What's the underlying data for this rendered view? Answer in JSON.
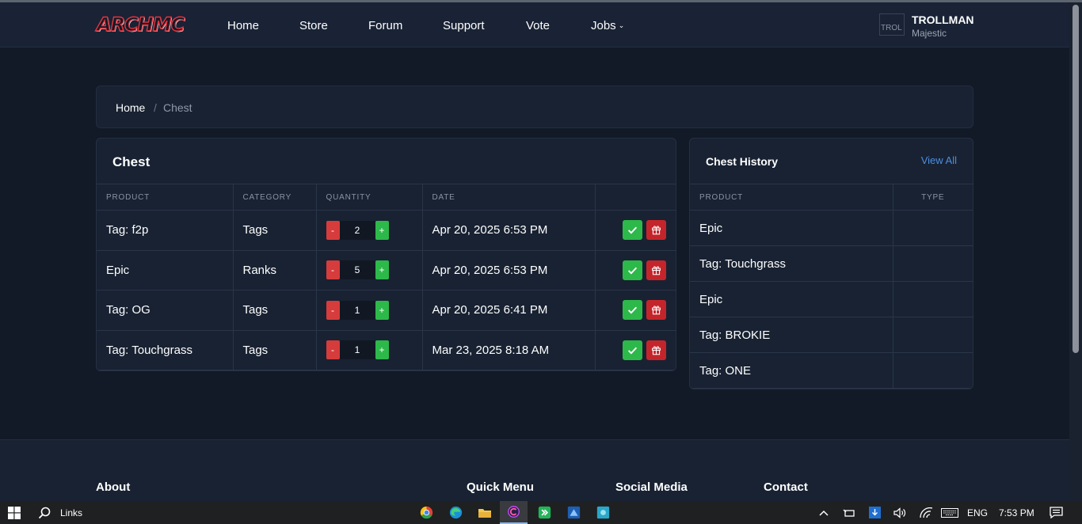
{
  "brand": {
    "logo_text": "ARCHMC"
  },
  "nav": {
    "items": [
      {
        "label": "Home"
      },
      {
        "label": "Store"
      },
      {
        "label": "Forum"
      },
      {
        "label": "Support"
      },
      {
        "label": "Vote"
      },
      {
        "label": "Jobs"
      }
    ]
  },
  "user": {
    "name": "TROLLMAN",
    "rank": "Majestic",
    "avatar_alt": "TROL"
  },
  "breadcrumb": {
    "home": "Home",
    "separator": "/",
    "current": "Chest"
  },
  "chest": {
    "title": "Chest",
    "columns": [
      "PRODUCT",
      "CATEGORY",
      "QUANTITY",
      "DATE",
      ""
    ],
    "rows": [
      {
        "product": "Tag: f2p",
        "category": "Tags",
        "quantity": "2",
        "date": "Apr 20, 2025 6:53 PM"
      },
      {
        "product": "Epic",
        "category": "Ranks",
        "quantity": "5",
        "date": "Apr 20, 2025 6:53 PM"
      },
      {
        "product": "Tag: OG",
        "category": "Tags",
        "quantity": "1",
        "date": "Apr 20, 2025 6:41 PM"
      },
      {
        "product": "Tag: Touchgrass",
        "category": "Tags",
        "quantity": "1",
        "date": "Mar 23, 2025 8:18 AM"
      }
    ],
    "minus_label": "-",
    "plus_label": "+"
  },
  "history": {
    "title": "Chest History",
    "view_all": "View All",
    "columns": [
      "PRODUCT",
      "TYPE"
    ],
    "rows": [
      {
        "product": "Epic",
        "type": ""
      },
      {
        "product": "Tag: Touchgrass",
        "type": ""
      },
      {
        "product": "Epic",
        "type": ""
      },
      {
        "product": "Tag: BROKIE",
        "type": ""
      },
      {
        "product": "Tag: ONE",
        "type": ""
      }
    ]
  },
  "footer": {
    "headings": {
      "about": "About",
      "quick_menu": "Quick Menu",
      "social_media": "Social Media",
      "contact": "Contact"
    }
  },
  "taskbar": {
    "search_label": "Links",
    "language": "ENG",
    "time": "7:53 PM",
    "apps": [
      "chrome-icon",
      "edge-icon",
      "file-explorer-icon",
      "app-c-icon",
      "app-green-icon",
      "app-blue-icon",
      "app-teal-icon"
    ]
  },
  "colors": {
    "background": "#121a27",
    "card": "#182232",
    "accent_link": "#4d8fe0",
    "success": "#2db84a",
    "danger": "#c4252b"
  }
}
